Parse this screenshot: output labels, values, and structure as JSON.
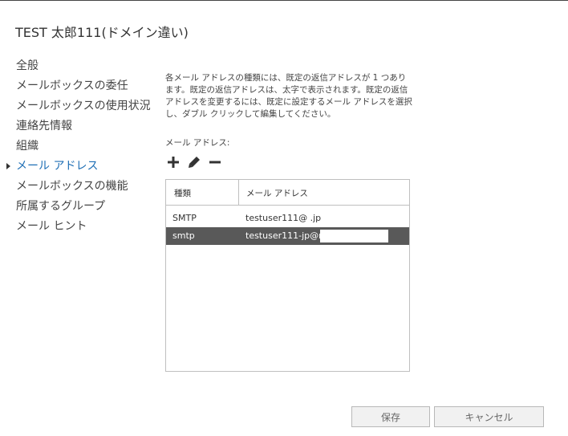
{
  "dialog": {
    "title": "TEST 太郎111(ドメイン違い)"
  },
  "nav": {
    "items": [
      {
        "label": "全般"
      },
      {
        "label": "メールボックスの委任"
      },
      {
        "label": "メールボックスの使用状況"
      },
      {
        "label": "連絡先情報"
      },
      {
        "label": "組織"
      },
      {
        "label": "メール アドレス",
        "active": true
      },
      {
        "label": "メールボックスの機能"
      },
      {
        "label": "所属するグループ"
      },
      {
        "label": "メール ヒント"
      }
    ]
  },
  "content": {
    "description": "各メール アドレスの種類には、既定の返信アドレスが 1 つあります。既定の返信アドレスは、太字で表示されます。既定の返信アドレスを変更するには、既定に設定するメール アドレスを選択し、ダブル クリックして編集してください。",
    "address_label": "メール アドレス:",
    "toolbar": {
      "add_icon": "plus-icon",
      "edit_icon": "pencil-icon",
      "remove_icon": "minus-icon"
    },
    "grid": {
      "columns": [
        "種類",
        "メール アドレス"
      ],
      "rows": [
        {
          "type": "SMTP",
          "address": "testuser111@               .jp",
          "selected": false
        },
        {
          "type": "smtp",
          "address": "testuser111-jp@r                        .o...",
          "selected": true
        }
      ]
    }
  },
  "buttons": {
    "save": "保存",
    "cancel": "キャンセル"
  },
  "colors": {
    "active_nav": "#1f6fb5",
    "selected_row": "#595959"
  }
}
